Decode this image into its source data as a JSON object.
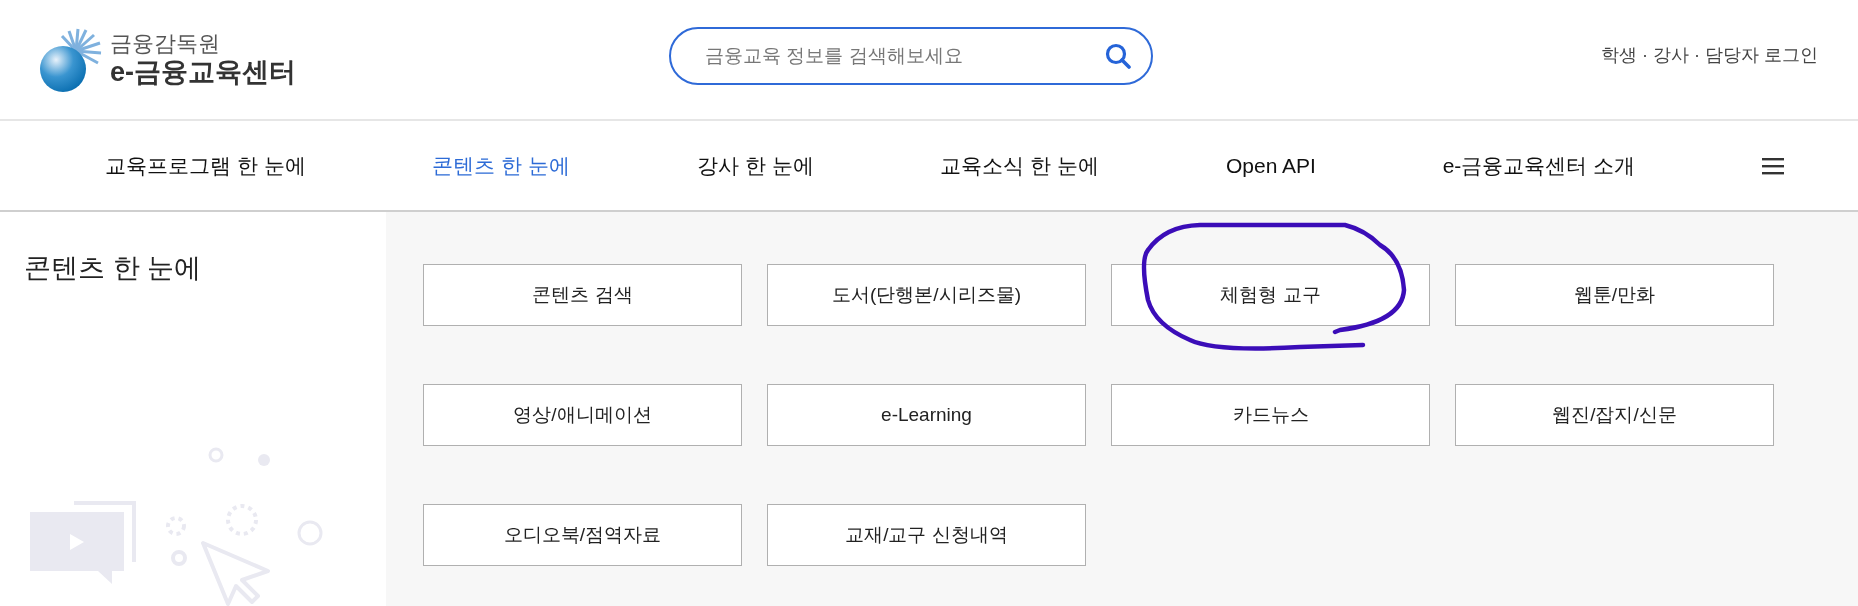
{
  "logo": {
    "org": "금융감독원",
    "name": "e-금융교육센터"
  },
  "search": {
    "placeholder": "금융교육 정보를 검색해보세요"
  },
  "login_link": "학생 · 강사 · 담당자 로그인",
  "nav": [
    {
      "label": "교육프로그램 한 눈에",
      "selected": false
    },
    {
      "label": "콘텐츠 한 눈에",
      "selected": true
    },
    {
      "label": "강사 한 눈에",
      "selected": false
    },
    {
      "label": "교육소식 한 눈에",
      "selected": false
    },
    {
      "label": "Open API",
      "selected": false
    },
    {
      "label": "e-금융교육센터 소개",
      "selected": false
    }
  ],
  "section_title": "콘텐츠 한 눈에",
  "categories": [
    "콘텐츠 검색",
    "도서(단행본/시리즈물)",
    "체험형 교구",
    "웹툰/만화",
    "영상/애니메이션",
    "e-Learning",
    "카드뉴스",
    "웹진/잡지/신문",
    "오디오북/점역자료",
    "교재/교구 신청내역"
  ]
}
